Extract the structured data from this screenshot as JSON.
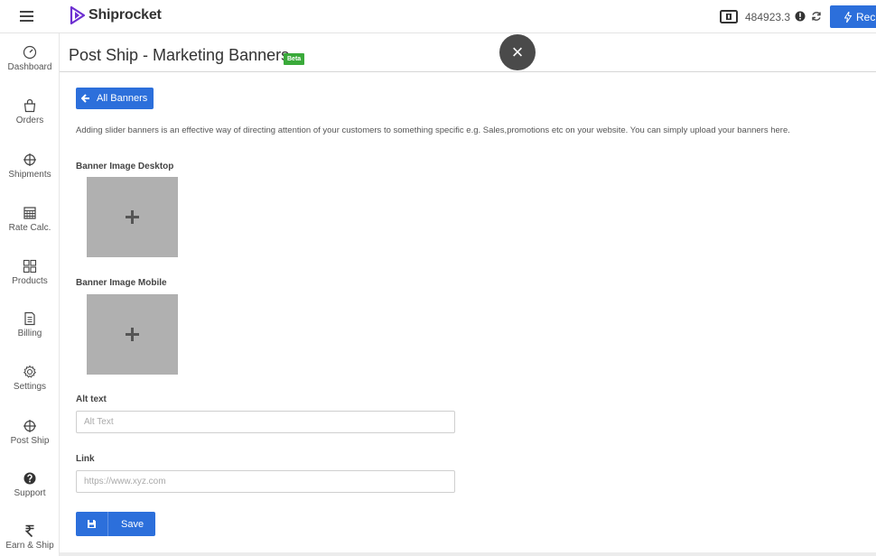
{
  "topbar": {
    "brand": "Shiprocket",
    "balance": "484923.3",
    "recharge_label": "Rech"
  },
  "sidebar": {
    "items": [
      {
        "label": "Dashboard",
        "icon": "speedometer-icon"
      },
      {
        "label": "Orders",
        "icon": "shopping-bag-icon"
      },
      {
        "label": "Shipments",
        "icon": "crosshair-icon"
      },
      {
        "label": "Rate Calc.",
        "icon": "calculator-icon"
      },
      {
        "label": "Products",
        "icon": "grid-icon"
      },
      {
        "label": "Billing",
        "icon": "document-icon"
      },
      {
        "label": "Settings",
        "icon": "gear-icon"
      },
      {
        "label": "Post Ship",
        "icon": "crosshair-icon"
      },
      {
        "label": "Support",
        "icon": "question-circle-icon"
      },
      {
        "label": "Earn & Ship",
        "icon": "rupee-icon"
      }
    ]
  },
  "header": {
    "title": "Post Ship - Marketing Banners",
    "badge": "Beta"
  },
  "main": {
    "back_button_label": "All Banners",
    "description": "Adding slider banners is an effective way of directing attention of your customers to something specific e.g. Sales,promotions etc on your website. You can simply upload your banners here.",
    "desktop_label": "Banner Image Desktop",
    "mobile_label": "Banner Image Mobile",
    "alt_label": "Alt text",
    "alt_placeholder": "Alt Text",
    "link_label": "Link",
    "link_placeholder": "https://www.xyz.com",
    "save_label": "Save"
  },
  "colors": {
    "accent": "#2c6fdb",
    "beta_badge": "#3aaa3a",
    "upload_box": "#b0b0b0",
    "close_button": "#4a4a4a"
  }
}
